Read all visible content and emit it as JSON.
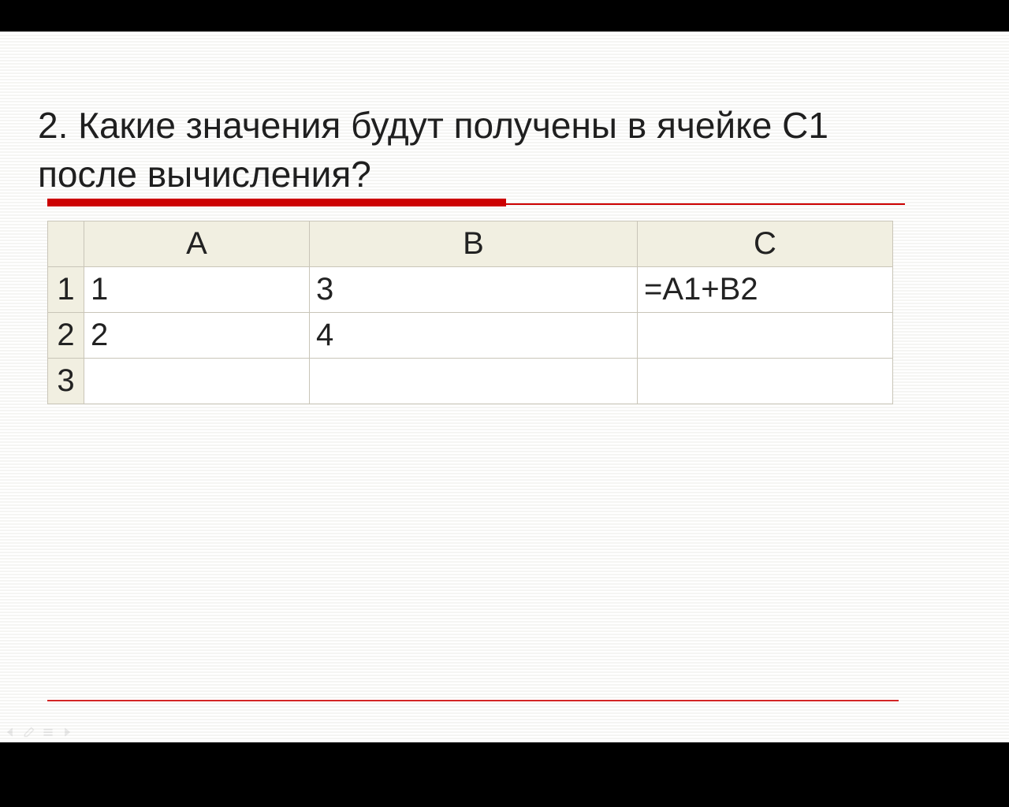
{
  "slide": {
    "title": "2. Какие значения будут получены в ячейке С1 после вычисления?"
  },
  "sheet": {
    "columns": [
      "A",
      "B",
      "C"
    ],
    "rowHeaders": [
      "1",
      "2",
      "3"
    ],
    "rows": [
      {
        "A": "1",
        "B": "3",
        "C": "=A1+B2"
      },
      {
        "A": "2",
        "B": "4",
        "C": ""
      },
      {
        "A": "",
        "B": "",
        "C": ""
      }
    ]
  },
  "colors": {
    "accent": "#cc0000",
    "sheetHeaderBg": "#f1efe1",
    "sheetBorder": "#c9c5b8"
  }
}
